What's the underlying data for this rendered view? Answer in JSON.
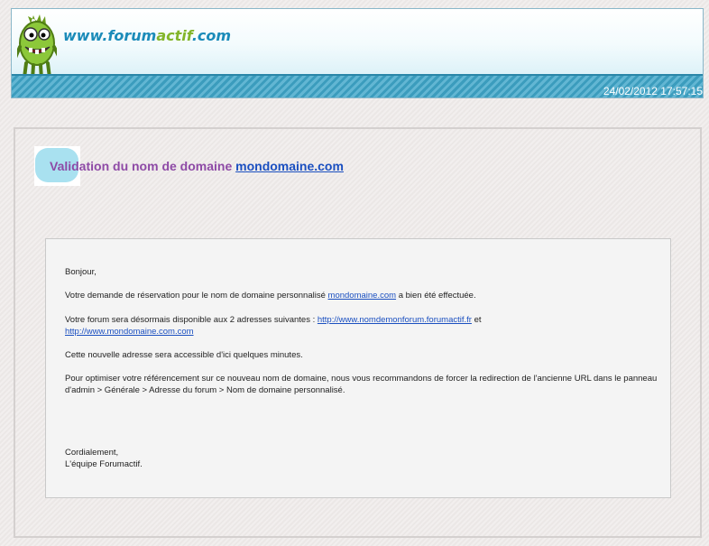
{
  "header": {
    "site_name_prefix": "www.forum",
    "site_name_mid": "actif",
    "site_name_suffix": ".com",
    "datetime": "24/02/2012 17:57:15"
  },
  "title": {
    "prefix": "Validation du nom de domaine",
    "domain_link": "mondomaine.com"
  },
  "message": {
    "greeting": "Bonjour,",
    "reservation_before": "Votre demande de réservation pour le nom de domaine personnalisé",
    "reservation_link": "mondomaine.com",
    "reservation_after": "a bien été effectuée.",
    "addresses_before": "Votre forum sera désormais disponible aux 2 adresses suivantes :",
    "address_link_1": "http://www.nomdemonforum.forumactif.fr",
    "addresses_and": "et",
    "address_link_2": "http://www.mondomaine.com.com",
    "accessible": "Cette nouvelle adresse sera accessible d'ici quelques minutes.",
    "seo": "Pour optimiser votre référencement sur ce nouveau nom de domaine, nous vous recommandons de forcer la redirection de l'ancienne URL dans le panneau d'admin > Générale > Adresse du forum > Nom de domaine personnalisé.",
    "closing": "Cordialement,",
    "signature": "L'équipe Forumactif."
  }
}
